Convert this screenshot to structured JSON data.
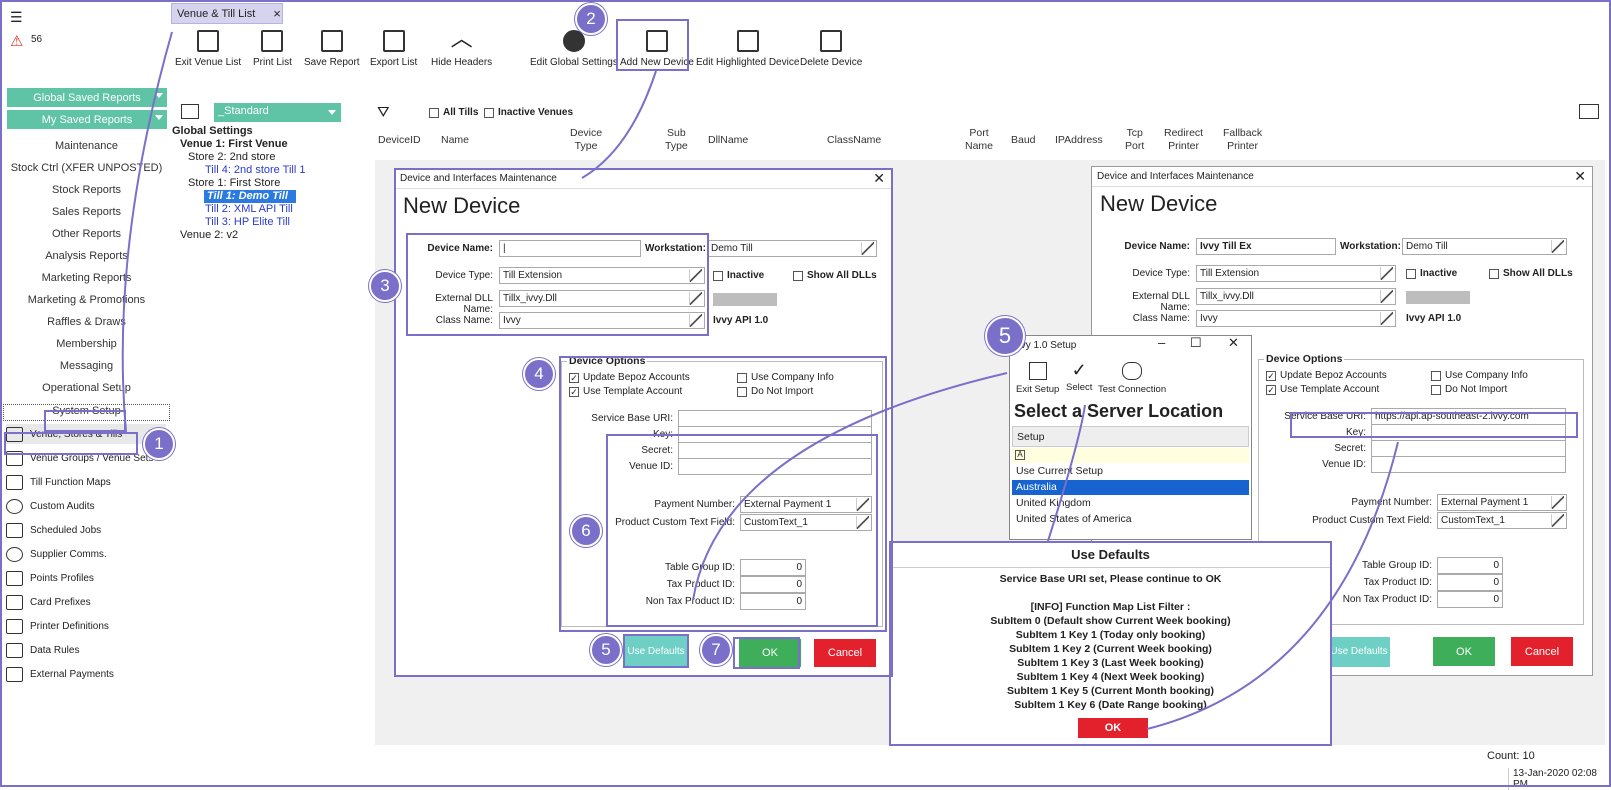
{
  "sidebar": {
    "alert_count": "56",
    "reports_buttons": [
      "Global Saved Reports",
      "My Saved Reports"
    ],
    "menu_items": [
      "Maintenance",
      "Stock Ctrl (XFER UNPOSTED)",
      "Stock Reports",
      "Sales Reports",
      "Other Reports",
      "Analysis Reports",
      "Marketing Reports",
      "Marketing & Promotions",
      "Raffles & Draws",
      "Membership",
      "Messaging",
      "Operational Setup",
      "System Setup"
    ],
    "nav_items": [
      "Venue, Stores & Tills",
      "Venue Groups / Venue Sets",
      "Till Function Maps",
      "Custom Audits",
      "Scheduled Jobs",
      "Supplier Comms.",
      "Points Profiles",
      "Card Prefixes",
      "Printer Definitions",
      "Data Rules",
      "External Payments"
    ]
  },
  "tab": {
    "label": "Venue & Till List",
    "close": "×"
  },
  "toolbar": [
    "Exit Venue List",
    "Print List",
    "Save Report",
    "Export List",
    "Hide Headers",
    "Edit Global Settings",
    "Add New Device",
    "Edit Highlighted Device",
    "Delete Device"
  ],
  "filter": {
    "view": "_Standard",
    "all_tills": "All Tills",
    "inactive_venues": "Inactive Venues"
  },
  "tree": {
    "root": "Global Settings",
    "venue1": "Venue 1: First Venue",
    "store2": "Store 2: 2nd store",
    "till4": "Till 4: 2nd store Till 1",
    "store1": "Store 1: First Store",
    "till1": "Till 1: Demo Till",
    "till2": "Till 2: XML API Till",
    "till3": "Till 3: HP Elite Till",
    "venue2": "Venue 2: v2"
  },
  "columns": [
    "DeviceID",
    "Name",
    "Device\nType",
    "Sub\nType",
    "DllName",
    "ClassName",
    "Port\nName",
    "Baud",
    "IPAddress",
    "Tcp\nPort",
    "Redirect\nPrinter",
    "Fallback\nPrinter"
  ],
  "dialog_left": {
    "title": "Device and Interfaces Maintenance",
    "heading": "New Device",
    "device_name_label": "Device Name:",
    "device_name_value": "|",
    "workstation_label": "Workstation:",
    "workstation_value": "Demo Till",
    "device_type_label": "Device Type:",
    "device_type_value": "Till Extension",
    "inactive": "Inactive",
    "show_all_dlls": "Show All DLLs",
    "dll_label": "External DLL Name:",
    "dll_value": "Tillx_ivvy.Dll",
    "class_label": "Class Name:",
    "class_value": "Ivvy",
    "api_version": "Ivvy API 1.0",
    "options_title": "Device Options",
    "opt_update": "Update Bepoz Accounts",
    "opt_template": "Use Template Account",
    "opt_company": "Use Company Info",
    "opt_noimport": "Do Not Import",
    "service_uri_label": "Service Base URI:",
    "key_label": "Key:",
    "secret_label": "Secret:",
    "venue_id_label": "Venue ID:",
    "payment_label": "Payment Number:",
    "payment_value": "External Payment 1",
    "custom_label": "Product Custom Text Field:",
    "custom_value": "CustomText_1",
    "table_group_label": "Table Group ID:",
    "table_group_value": "0",
    "tax_label": "Tax Product ID:",
    "tax_value": "0",
    "nontax_label": "Non Tax Product ID:",
    "nontax_value": "0",
    "use_defaults": "Use Defaults",
    "ok": "OK",
    "cancel": "Cancel"
  },
  "dialog_right": {
    "title": "Device and Interfaces Maintenance",
    "heading": "New Device",
    "device_name_value": "Ivvy Till Ex",
    "service_uri_value": "https://api.ap-southeast-2.ivvy.com",
    "use_defaults": "Use Defaults"
  },
  "setup_dialog": {
    "title": "Ivvy 1.0 Setup",
    "tools": [
      "Exit Setup",
      "Select",
      "Test Connection"
    ],
    "heading": "Select a Server Location",
    "column": "Setup",
    "rows": [
      "Use Current Setup",
      "Australia",
      "United Kingdom",
      "United States of America"
    ]
  },
  "popup": {
    "title": "Use Defaults",
    "lines": [
      "Service Base URI set, Please continue to OK",
      "",
      "[INFO] Function Map List Filter :",
      "SubItem 0 (Default show Current Week booking)",
      "SubItem 1  Key 1 (Today only booking)",
      "SubItem 1  Key 2 (Current Week booking)",
      "SubItem 1  Key 3 (Last Week booking)",
      "SubItem 1  Key 4 (Next Week booking)",
      "SubItem 1  Key 5 (Current Month booking)",
      "SubItem 1  Key 6 (Date Range booking)"
    ],
    "ok": "OK"
  },
  "badges": [
    "1",
    "2",
    "3",
    "4",
    "5",
    "6",
    "7",
    "5"
  ],
  "status": {
    "count": "Count: 10",
    "datetime": "13-Jan-2020  02:08 PM"
  },
  "colors": {
    "accent": "#7a6fc9",
    "green": "#3fae5a",
    "red": "#e2212c",
    "teal": "#5fc3a6"
  }
}
